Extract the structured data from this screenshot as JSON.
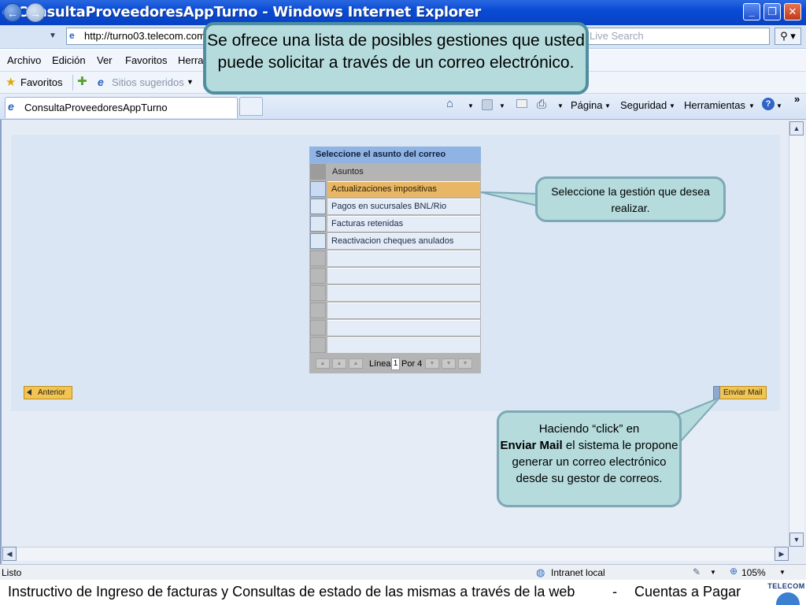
{
  "window": {
    "title": "ConsultaProveedoresAppTurno - Windows Internet Explorer"
  },
  "addressbar": {
    "url": "http://turno03.telecom.com",
    "search_placeholder": "Live Search"
  },
  "menu": [
    "Archivo",
    "Edición",
    "Ver",
    "Favoritos",
    "Herra"
  ],
  "favorites": {
    "label": "Favoritos",
    "sites_label": "Sitios sugeridos"
  },
  "tabs": {
    "active": "ConsultaProveedoresAppTurno"
  },
  "commandbar": {
    "pagina": "Página",
    "seguridad": "Seguridad",
    "herramientas": "Herramientas"
  },
  "table": {
    "header": "Seleccione el asunto del correo",
    "column": "Asuntos",
    "rows": [
      "Actualizaciones impositivas",
      "Pagos en sucursales BNL/Rio",
      "Facturas retenidas",
      "Reactivacion cheques anulados"
    ],
    "footer": {
      "line_label": "Línea",
      "line_value": "1",
      "of_label": "Por 4"
    }
  },
  "buttons": {
    "anterior": "Anterior",
    "enviar": "Enviar Mail"
  },
  "callouts": {
    "top": "Se ofrece una lista de posibles gestiones que usted puede solicitar a través de un correo electrónico.",
    "right": "Seleccione  la gestión que desea realizar.",
    "bottom_pre": "Haciendo “click”  en",
    "bottom_bold": "Enviar Mail",
    "bottom_post": " el sistema le propone  generar un correo electrónico desde su gestor de correos."
  },
  "statusbar": {
    "status": "Listo",
    "zone": "Intranet local",
    "zoom": "105%"
  },
  "footer": {
    "text": "Instructivo de Ingreso de facturas y Consultas de estado de las mismas a través de la web",
    "separator": "-",
    "section": "Cuentas a Pagar",
    "logo": "TELECOM"
  },
  "colors": {
    "titlebar": "#0a4bd6",
    "highlight_row": "#e8b765",
    "callout_fill": "#b5dbdc",
    "button": "#f2c552"
  }
}
